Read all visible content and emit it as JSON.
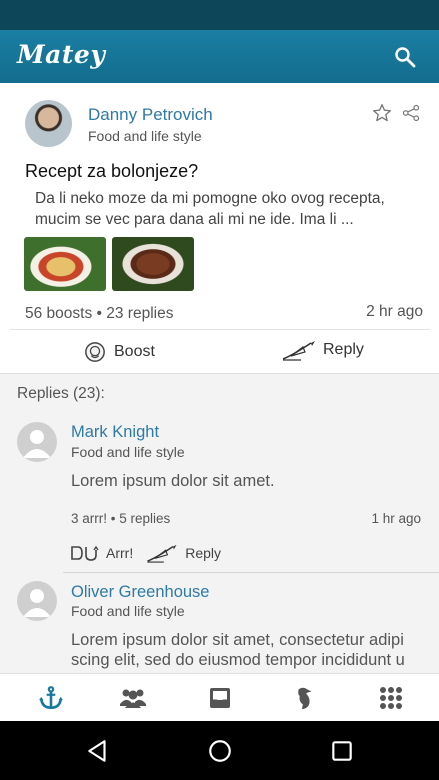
{
  "app": {
    "title": "Matey",
    "accent": "#1779a0"
  },
  "post": {
    "author": "Danny Petrovich",
    "category": "Food and life style",
    "title": "Recept za bolonjeze?",
    "body_line1": "Da li neko moze da mi pomogne oko ovog recepta,",
    "body_line2": "mucim se vec para dana ali mi ne ide. Ima li ...",
    "stats": "56 boosts • 23 replies",
    "time": "2 hr ago",
    "boost_label": "Boost",
    "reply_label": "Reply"
  },
  "replies": {
    "header": "Replies (23):",
    "items": [
      {
        "name": "Mark Knight",
        "category": "Food and life style",
        "text_line1": "Lorem ipsum dolor sit amet.",
        "stats": "3 arrr! • 5 replies",
        "time": "1 hr ago",
        "arr_label": "Arrr!",
        "reply_label": "Reply"
      },
      {
        "name": "Oliver Greenhouse",
        "category": "Food and life style",
        "text_line1": "Lorem ipsum dolor sit amet, consectetur adipi",
        "text_line2": "scing elit, sed do eiusmod tempor incididunt u"
      }
    ]
  },
  "tabs": [
    "anchor-icon",
    "group-icon",
    "inbox-icon",
    "parrot-icon",
    "apps-grid-icon"
  ],
  "navbar": [
    "back-icon",
    "home-icon",
    "recents-icon"
  ]
}
